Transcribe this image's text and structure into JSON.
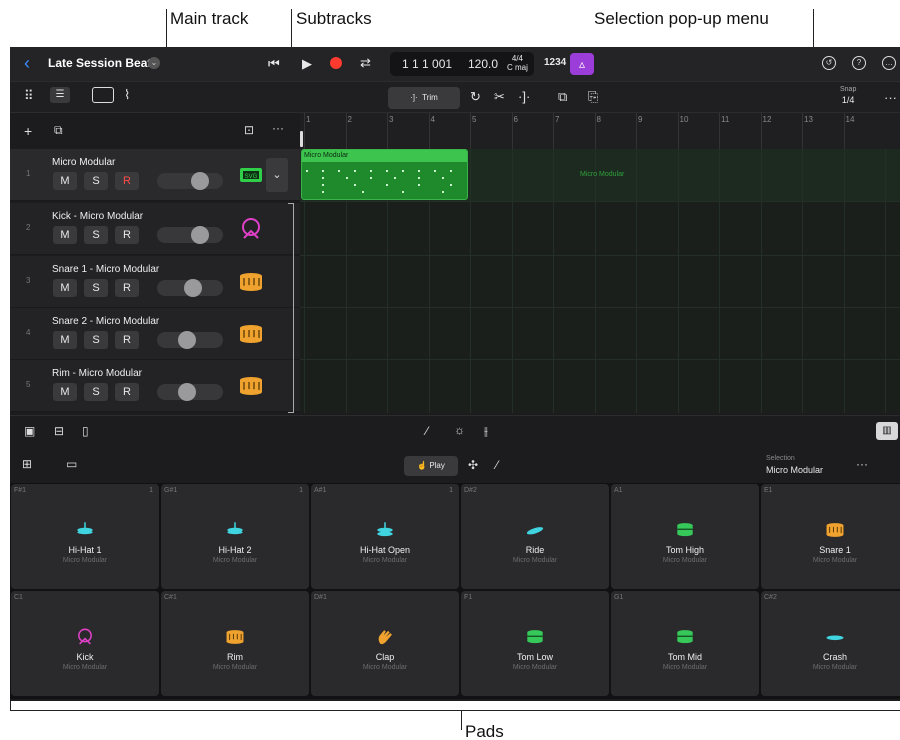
{
  "callouts": {
    "main_track": "Main track",
    "subtracks": "Subtracks",
    "selection_menu": "Selection pop-up menu",
    "pads": "Pads"
  },
  "header": {
    "title": "Late Session Beat",
    "position": "1 1 1 001",
    "tempo": "120.0",
    "time_signature": "4/4",
    "key": "C maj",
    "count_in": "1234"
  },
  "toolbar": {
    "trim_label": "Trim",
    "snap_label": "Snap",
    "snap_value": "1/4"
  },
  "ruler": [
    "1",
    "2",
    "3",
    "4",
    "5",
    "6",
    "7",
    "8",
    "9",
    "10",
    "11",
    "12",
    "13",
    "14"
  ],
  "tracks": [
    {
      "num": "1",
      "name": "Micro Modular",
      "m": "M",
      "s": "S",
      "r": "R",
      "volume": 0.65,
      "icon": "drum-machine-icon"
    },
    {
      "num": "2",
      "name": "Kick - Micro Modular",
      "m": "M",
      "s": "S",
      "r": "R",
      "volume": 0.65,
      "icon": "kick-drum-icon"
    },
    {
      "num": "3",
      "name": "Snare 1 - Micro Modular",
      "m": "M",
      "s": "S",
      "r": "R",
      "volume": 0.55,
      "icon": "snare-drum-icon"
    },
    {
      "num": "4",
      "name": "Snare 2 - Micro Modular",
      "m": "M",
      "s": "S",
      "r": "R",
      "volume": 0.45,
      "icon": "snare-drum-icon"
    },
    {
      "num": "5",
      "name": "Rim - Micro Modular",
      "m": "M",
      "s": "S",
      "r": "R",
      "volume": 0.45,
      "icon": "snare-drum-icon"
    }
  ],
  "region": {
    "name": "Micro Modular",
    "ghost_label": "Micro Modular"
  },
  "lower": {
    "play_label": "Play",
    "selection_label": "Selection",
    "selection_value": "Micro Modular"
  },
  "pads": [
    {
      "note": "F#1",
      "count": "1",
      "name": "Hi-Hat 1",
      "kit": "Micro Modular",
      "icon": "hihat-icon",
      "color": "#3fd4e0"
    },
    {
      "note": "G#1",
      "count": "1",
      "name": "Hi-Hat 2",
      "kit": "Micro Modular",
      "icon": "hihat-icon",
      "color": "#3fd4e0"
    },
    {
      "note": "A#1",
      "count": "1",
      "name": "Hi-Hat Open",
      "kit": "Micro Modular",
      "icon": "hihat-open-icon",
      "color": "#3fd4e0"
    },
    {
      "note": "D#2",
      "count": "",
      "name": "Ride",
      "kit": "Micro Modular",
      "icon": "ride-cymbal-icon",
      "color": "#3fd4e0"
    },
    {
      "note": "A1",
      "count": "",
      "name": "Tom High",
      "kit": "Micro Modular",
      "icon": "tom-icon",
      "color": "#37c85a"
    },
    {
      "note": "E1",
      "count": "",
      "name": "Snare 1",
      "kit": "Micro Modular",
      "icon": "snare-drum-icon",
      "color": "#f0a22e"
    },
    {
      "note": "C1",
      "count": "",
      "name": "Kick",
      "kit": "Micro Modular",
      "icon": "kick-drum-icon",
      "color": "#e040c8"
    },
    {
      "note": "C#1",
      "count": "",
      "name": "Rim",
      "kit": "Micro Modular",
      "icon": "snare-drum-icon",
      "color": "#f0a22e"
    },
    {
      "note": "D#1",
      "count": "",
      "name": "Clap",
      "kit": "Micro Modular",
      "icon": "clap-hand-icon",
      "color": "#f0a22e"
    },
    {
      "note": "F1",
      "count": "",
      "name": "Tom Low",
      "kit": "Micro Modular",
      "icon": "tom-icon",
      "color": "#37c85a"
    },
    {
      "note": "G1",
      "count": "",
      "name": "Tom Mid",
      "kit": "Micro Modular",
      "icon": "tom-icon",
      "color": "#37c85a"
    },
    {
      "note": "C#2",
      "count": "",
      "name": "Crash",
      "kit": "Micro Modular",
      "icon": "crash-cymbal-icon",
      "color": "#3fd4e0"
    }
  ]
}
